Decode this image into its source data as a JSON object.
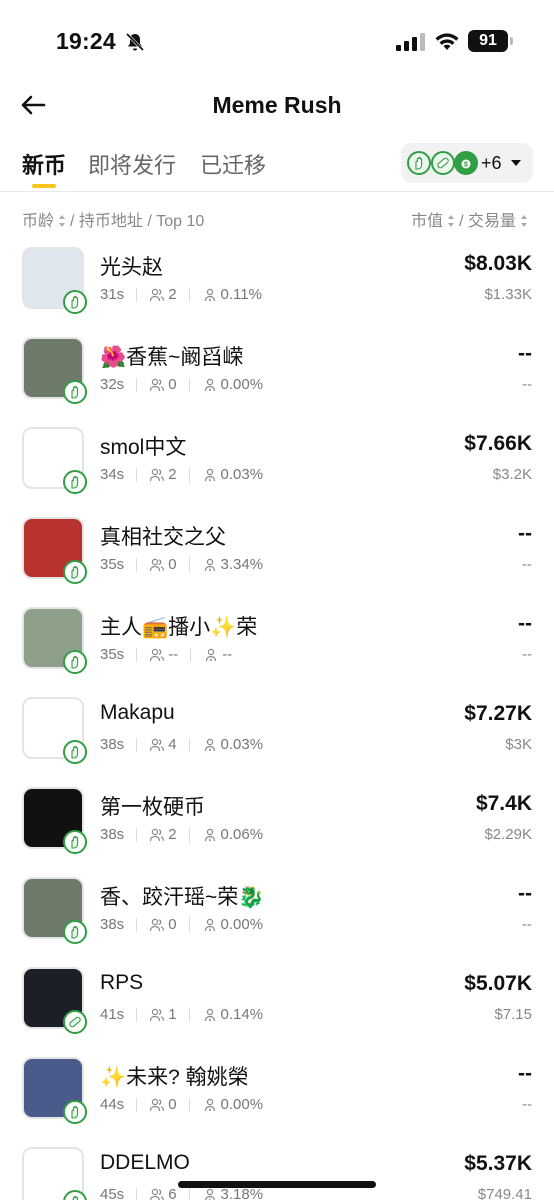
{
  "status_bar": {
    "time": "19:24",
    "battery": "91"
  },
  "header": {
    "title": "Meme Rush"
  },
  "tabs": [
    {
      "label": "新币"
    },
    {
      "label": "即将发行"
    },
    {
      "label": "已迁移"
    }
  ],
  "filter": {
    "extra_count": "+6"
  },
  "sort": {
    "left": {
      "age": "币龄",
      "sep1": "/ 持币地址 / Top 10"
    },
    "right": {
      "mcap": "市值",
      "sep": "/ 交易量"
    }
  },
  "tokens": [
    {
      "name": "光头赵",
      "age": "31s",
      "holders": "2",
      "top10": "0.11%",
      "mcap": "$8.03K",
      "volume": "$1.33K",
      "badge": "hand",
      "avatar_color": "#dfe6ee"
    },
    {
      "name": "🌺香蕉~阚舀嵘",
      "age": "32s",
      "holders": "0",
      "top10": "0.00%",
      "mcap": "--",
      "volume": "--",
      "badge": "hand",
      "avatar_color": "#6e7b6a"
    },
    {
      "name": "smol中文",
      "age": "34s",
      "holders": "2",
      "top10": "0.03%",
      "mcap": "$7.66K",
      "volume": "$3.2K",
      "badge": "hand",
      "avatar_color": "#ffffff"
    },
    {
      "name": "真相社交之父",
      "age": "35s",
      "holders": "0",
      "top10": "3.34%",
      "mcap": "--",
      "volume": "--",
      "badge": "hand",
      "avatar_color": "#b8332e"
    },
    {
      "name": "主人📻播小✨荣",
      "age": "35s",
      "holders": "--",
      "top10": "--",
      "mcap": "--",
      "volume": "--",
      "badge": "hand",
      "avatar_color": "#8fa08a"
    },
    {
      "name": "Makapu",
      "age": "38s",
      "holders": "4",
      "top10": "0.03%",
      "mcap": "$7.27K",
      "volume": "$3K",
      "badge": "hand",
      "avatar_color": "#ffffff"
    },
    {
      "name": "第一枚硬币",
      "age": "38s",
      "holders": "2",
      "top10": "0.06%",
      "mcap": "$7.4K",
      "volume": "$2.29K",
      "badge": "hand",
      "avatar_color": "#111111"
    },
    {
      "name": "香、跤汗瑶~荣🐉",
      "age": "38s",
      "holders": "0",
      "top10": "0.00%",
      "mcap": "--",
      "volume": "--",
      "badge": "hand",
      "avatar_color": "#6e7b6a"
    },
    {
      "name": "RPS",
      "age": "41s",
      "holders": "1",
      "top10": "0.14%",
      "mcap": "$5.07K",
      "volume": "$7.15",
      "badge": "pill",
      "avatar_color": "#1c1f26"
    },
    {
      "name": "✨未来? 翰姚榮",
      "age": "44s",
      "holders": "0",
      "top10": "0.00%",
      "mcap": "--",
      "volume": "--",
      "badge": "hand",
      "avatar_color": "#4a5a8a"
    },
    {
      "name": "DDELMO",
      "age": "45s",
      "holders": "6",
      "top10": "3.18%",
      "mcap": "$5.37K",
      "volume": "$749.41",
      "badge": "hand",
      "avatar_color": "#ffffff"
    }
  ]
}
